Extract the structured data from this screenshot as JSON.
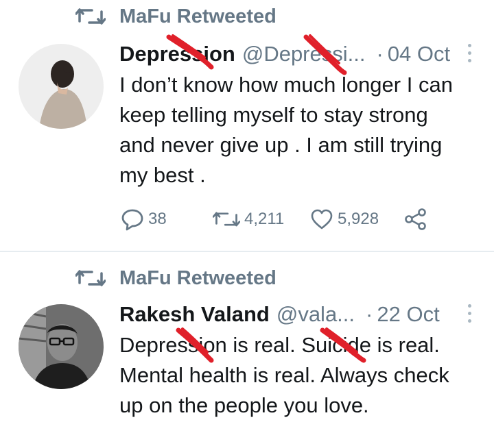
{
  "tweets": [
    {
      "retweeted_by": "MaFu Retweeted",
      "name": "Depression",
      "handle": "@Depressi...",
      "time": "04 Oct",
      "text_lines": [
        "I don’t know how much longer I can",
        "keep telling myself to stay strong",
        "and never give up . I am still trying",
        "my best ."
      ],
      "replies": "38",
      "retweets": "4,211",
      "likes": "5,928"
    },
    {
      "retweeted_by": "MaFu Retweeted",
      "name": "Rakesh Valand",
      "handle": "@vala...",
      "time": "22 Oct",
      "text_lines": [
        "Depression is real. Suicide is real.",
        "Mental health is real. Always check",
        "up on the people you love."
      ]
    }
  ],
  "separator": "·",
  "colors": {
    "text": "#14171a",
    "secondary": "#657786",
    "divider": "#e6ecf0",
    "scribble": "#e0202a"
  },
  "icons": [
    "retweet-icon",
    "reply-icon",
    "heart-icon",
    "share-icon",
    "more-icon"
  ]
}
